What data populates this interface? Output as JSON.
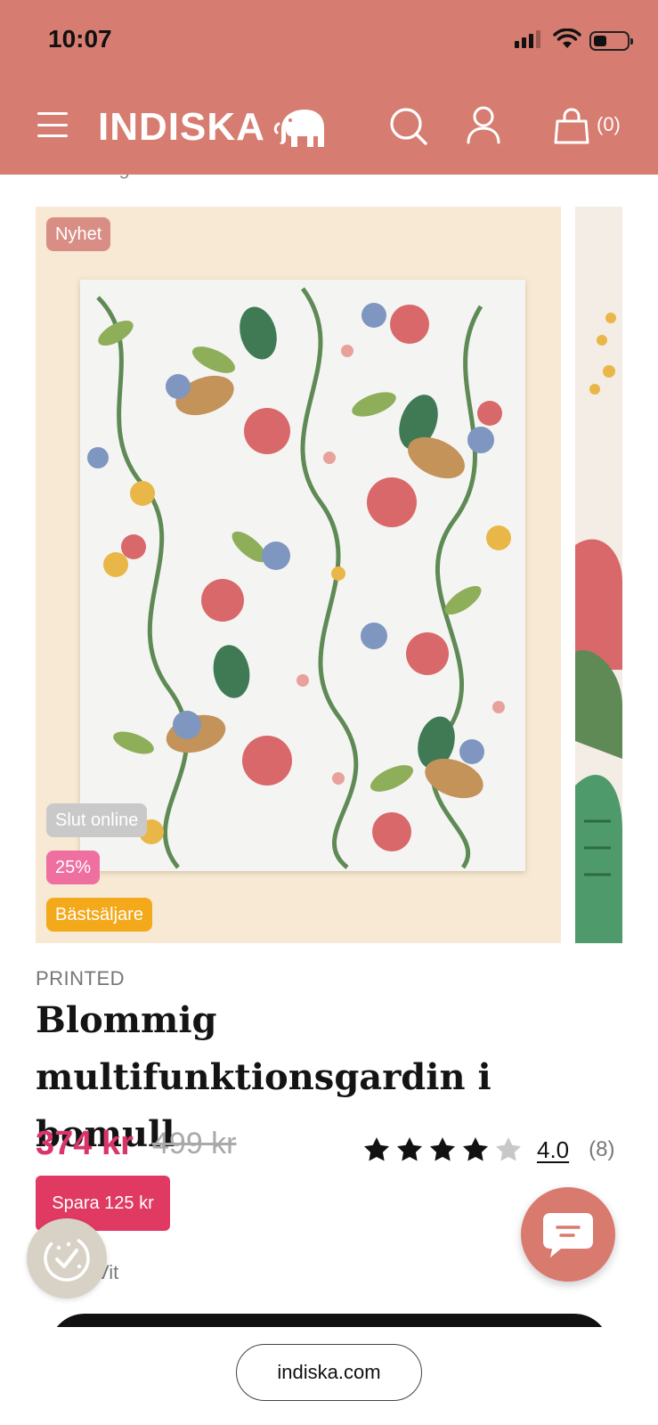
{
  "status_bar": {
    "time": "10:07"
  },
  "header": {
    "logo_text": "INDISKA",
    "cart_count": "(0)",
    "background_color": "#d67c70"
  },
  "breadcrumb": "Inredning / Hemtextil / Gardiner",
  "gallery": {
    "badges": {
      "new": "Nyhet",
      "sold_out": "Slut online",
      "discount": "25%",
      "bestseller": "Bästsäljare"
    }
  },
  "product": {
    "brand": "PRINTED",
    "title": "Blommig multifunktionsgardin i bomull",
    "price_now": "374 kr",
    "price_old": "499 kr",
    "rating_value": "4.0",
    "rating_count": "(8)",
    "rating_stars": 4,
    "save_text": "Spara 125 kr",
    "color_label": "Vit",
    "accent_color": "#e03a62"
  },
  "browser": {
    "url": "indiska.com"
  },
  "icons": [
    "hamburger-menu-icon",
    "elephant-logo-icon",
    "search-icon",
    "account-icon",
    "cart-icon",
    "star-icon",
    "cookie-consent-icon",
    "chat-icon"
  ]
}
